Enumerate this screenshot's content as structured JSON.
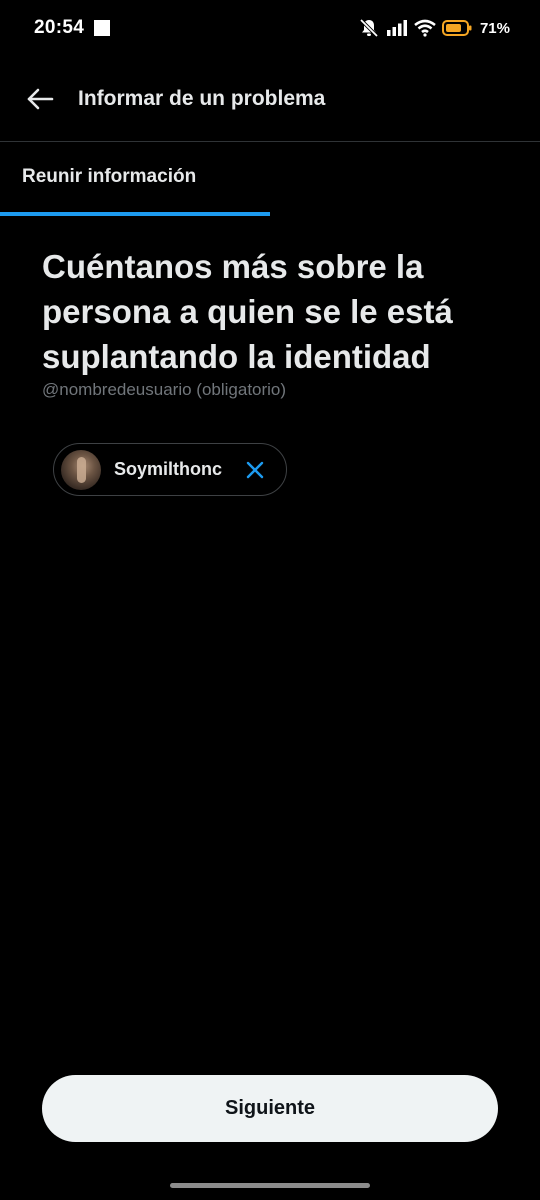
{
  "status_bar": {
    "time": "20:54",
    "battery_percent": "71%",
    "icons": [
      "notification-square-icon",
      "silent-icon",
      "signal-icon",
      "wifi-icon",
      "battery-icon"
    ],
    "battery_color": "#f5a623"
  },
  "header": {
    "back_icon": "arrow-left-icon",
    "title": "Informar de un problema"
  },
  "step": {
    "label": "Reunir información",
    "progress": 0.5,
    "accent_color": "#1d9bf0"
  },
  "form": {
    "question": "Cuéntanos más sobre la persona a quien se le está suplantando la identidad",
    "hint": "@nombredeusuario (obligatorio)",
    "selected_user": {
      "name": "Soymilthonc",
      "remove_icon": "close-icon"
    }
  },
  "actions": {
    "next_label": "Siguiente"
  }
}
